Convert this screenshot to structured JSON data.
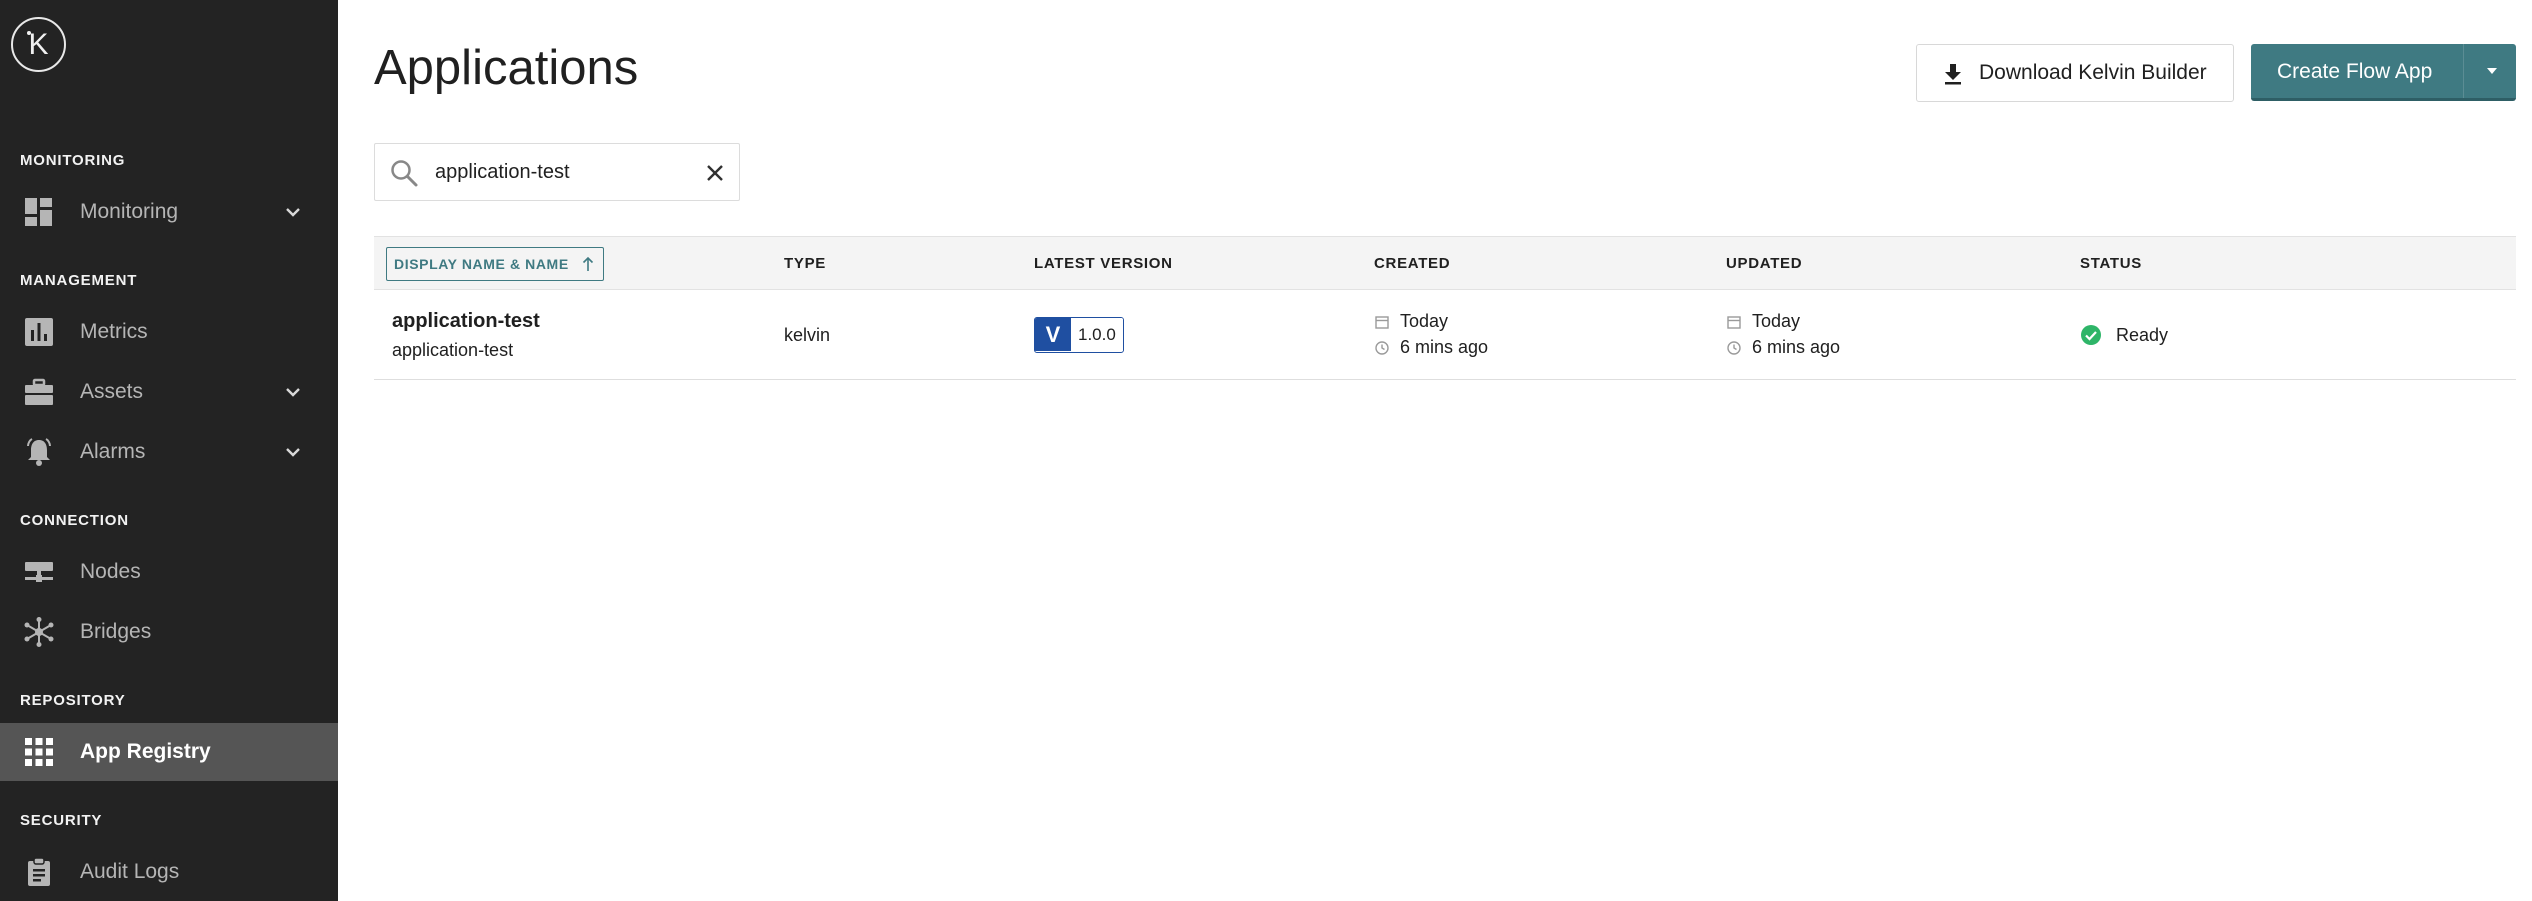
{
  "logo": {
    "letter": "K"
  },
  "sidebar": {
    "sections": [
      {
        "label": "MONITORING"
      },
      {
        "label": "MANAGEMENT"
      },
      {
        "label": "CONNECTION"
      },
      {
        "label": "REPOSITORY"
      },
      {
        "label": "SECURITY"
      }
    ],
    "items": [
      {
        "label": "Monitoring",
        "icon": "dashboard-icon",
        "expandable": true
      },
      {
        "label": "Metrics",
        "icon": "bar-chart-icon",
        "expandable": false
      },
      {
        "label": "Assets",
        "icon": "briefcase-icon",
        "expandable": true
      },
      {
        "label": "Alarms",
        "icon": "bell-icon",
        "expandable": true
      },
      {
        "label": "Nodes",
        "icon": "nodes-icon",
        "expandable": false
      },
      {
        "label": "Bridges",
        "icon": "bridges-icon",
        "expandable": false
      },
      {
        "label": "App Registry",
        "icon": "grid-icon",
        "expandable": false,
        "active": true
      },
      {
        "label": "Audit Logs",
        "icon": "clipboard-icon",
        "expandable": false
      }
    ]
  },
  "header": {
    "title": "Applications",
    "download_label": "Download Kelvin Builder",
    "create_label": "Create Flow App"
  },
  "search": {
    "value": "application-test"
  },
  "table": {
    "columns": {
      "name": "DISPLAY NAME & NAME",
      "type": "TYPE",
      "version": "LATEST VERSION",
      "created": "CREATED",
      "updated": "UPDATED",
      "status": "STATUS"
    },
    "rows": [
      {
        "display_name": "application-test",
        "name": "application-test",
        "type": "kelvin",
        "version_badge": "V",
        "version": "1.0.0",
        "created_date": "Today",
        "created_ago": "6 mins ago",
        "updated_date": "Today",
        "updated_ago": "6 mins ago",
        "status": "Ready"
      }
    ]
  },
  "colors": {
    "sidebar_bg": "#232323",
    "sidebar_active": "#555555",
    "accent_teal": "#3f7a82",
    "version_blue": "#1f4fa1",
    "status_green": "#2eb568"
  }
}
